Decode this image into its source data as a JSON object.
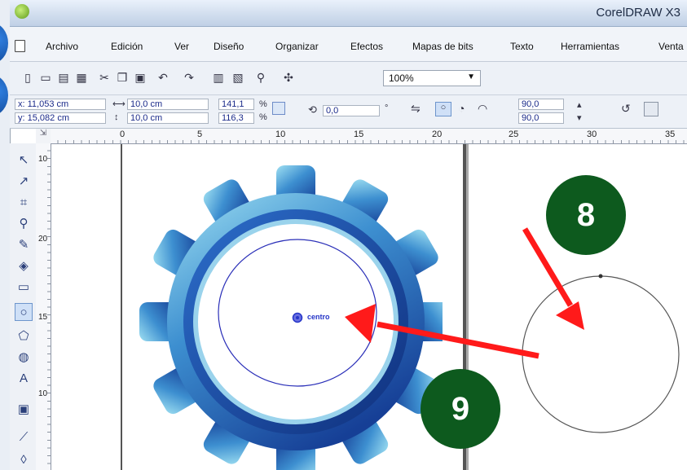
{
  "window": {
    "title": "CorelDRAW X3"
  },
  "menu": {
    "items": [
      "Archivo",
      "Edición",
      "Ver",
      "Diseño",
      "Organizar",
      "Efectos",
      "Mapas de bits",
      "Texto",
      "Herramientas",
      "Venta"
    ]
  },
  "toolbar": {
    "zoom": "100%",
    "icons": [
      "new-icon",
      "open-icon",
      "save-icon",
      "print-icon",
      "cut-icon",
      "copy-icon",
      "paste-icon",
      "undo-icon",
      "redo-icon",
      "import-icon",
      "export-icon",
      "launcher-icon",
      "welcome-icon"
    ]
  },
  "propbar": {
    "x": "x: 11,053 cm",
    "y": "y: 15,082 cm",
    "w": "10,0 cm",
    "h": "10,0 cm",
    "sx": "141,1",
    "sy": "116,3",
    "pct1": "%",
    "pct2": "%",
    "rotation": "0,0",
    "deg": "°",
    "angle1": "90,0",
    "angle2": "90,0"
  },
  "ruler": {
    "top": [
      "0",
      "5",
      "10",
      "15",
      "20",
      "25",
      "30",
      "35"
    ],
    "left": [
      "10",
      "20",
      "15",
      "10"
    ]
  },
  "canvas": {
    "center_label": "centro"
  },
  "callouts": {
    "first": "8",
    "second": "9"
  },
  "colors": {
    "callout_bg": "#0d5a1e",
    "arrow": "#ff1a1a",
    "gear_dark": "#1f4fa8",
    "gear_light": "#8ed2ec",
    "ellipse_stroke": "#2a2fb8"
  }
}
